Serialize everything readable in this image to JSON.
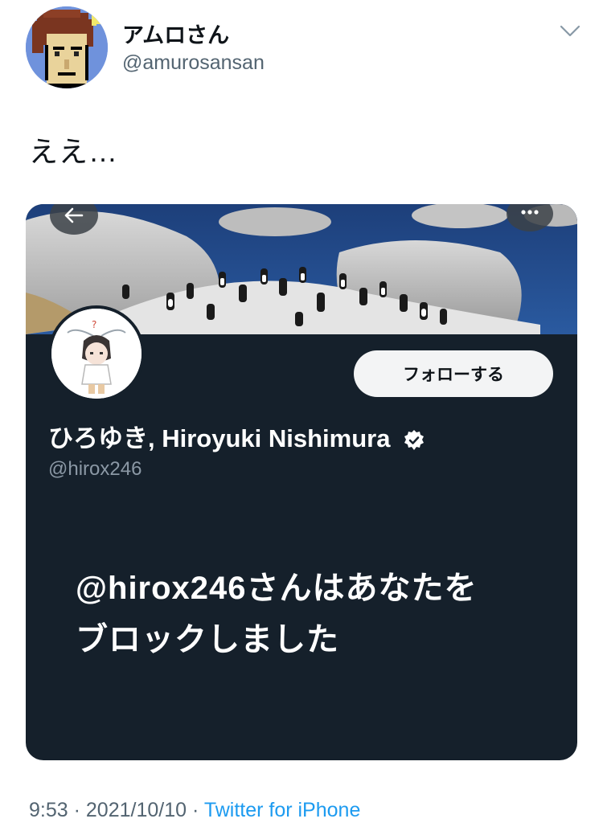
{
  "tweet": {
    "author": {
      "display_name": "アムロさん",
      "handle": "@amurosansan"
    },
    "text": "ええ…",
    "time": "9:53",
    "separator": "·",
    "date": "2021/10/10",
    "source": "Twitter for iPhone"
  },
  "card": {
    "profile_name": "ひろゆき, Hiroyuki Nishimura",
    "profile_handle": "@hirox246",
    "follow_label": "フォローする",
    "blocked_message": "@hirox246さんはあなたをブロックしました"
  },
  "icons": {
    "chevron": "chevron-down-icon",
    "back": "arrow-left-icon",
    "more": "more-dots-icon",
    "verified": "verified-badge-icon"
  },
  "colors": {
    "card_background": "#15202b",
    "link": "#1d9bf0",
    "secondary_text": "#536471"
  }
}
